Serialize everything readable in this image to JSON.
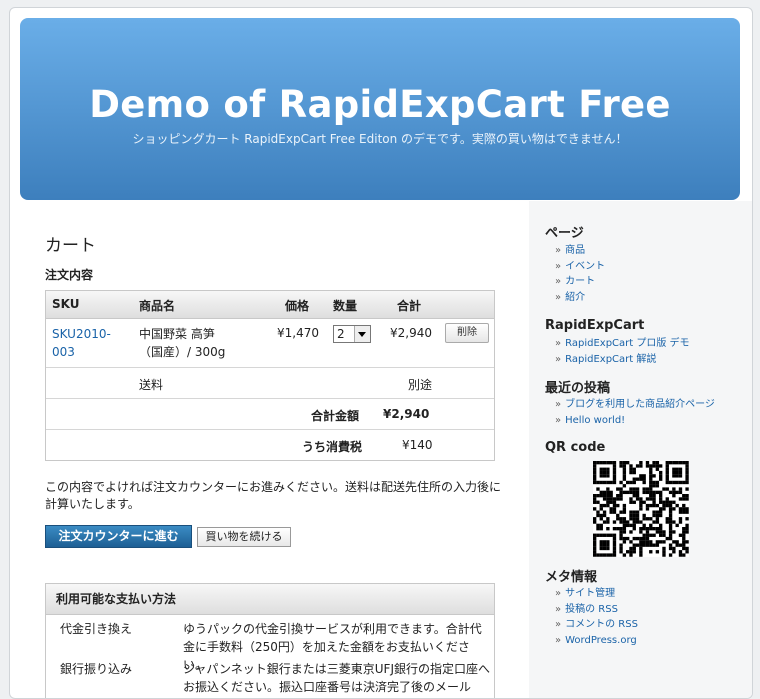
{
  "header": {
    "title": "Demo of RapidExpCart Free",
    "description": "ショッピングカート RapidExpCart Free Editon のデモです。実際の買い物はできません！"
  },
  "main": {
    "title": "カート",
    "order_heading": "注文内容",
    "table": {
      "headers": {
        "sku": "SKU",
        "name": "商品名",
        "price": "価格",
        "qty": "数量",
        "total": "合計"
      },
      "item": {
        "sku_line1": "SKU2010-",
        "sku_line2": "003",
        "name_line1": "中国野菜 高笋",
        "name_line2": "（国産）/ 300g",
        "price": "¥1,470",
        "qty": "2",
        "total": "¥2,940",
        "delete_label": "削除"
      },
      "shipping": {
        "label": "送料",
        "value": "別途"
      },
      "grand_total": {
        "label": "合計金額",
        "value": "¥2,940"
      },
      "tax": {
        "label": "うち消費税",
        "value": "¥140"
      }
    },
    "notice": "この内容でよければ注文カウンターにお進みください。送料は配送先住所の入力後に計算いたします。",
    "checkout_button": "注文カウンターに進む",
    "continue_button": "買い物を続ける",
    "payment": {
      "heading": "利用可能な支払い方法",
      "methods": [
        {
          "name": "代金引き換え",
          "desc": "ゆうパックの代金引換サービスが利用できます。合計代金に手数料（250円）を加えた金額をお支払いください。"
        },
        {
          "name": "銀行振り込み",
          "desc": "ジャパンネット銀行または三菱東京UFJ銀行の指定口座へお振込ください。振込口座番号は決済完了後のメール"
        }
      ]
    }
  },
  "sidebar": {
    "pages": {
      "heading": "ページ",
      "items": [
        "商品",
        "イベント",
        "カート",
        "紹介"
      ]
    },
    "rapid": {
      "heading": "RapidExpCart",
      "items": [
        "RapidExpCart プロ版 デモ",
        "RapidExpCart 解説"
      ]
    },
    "recent": {
      "heading": "最近の投稿",
      "items": [
        "ブログを利用した商品紹介ページ",
        "Hello world!"
      ]
    },
    "qr": {
      "heading": "QR code"
    },
    "meta": {
      "heading": "メタ情報",
      "items": [
        "サイト管理",
        "投稿の RSS",
        "コメントの RSS",
        "WordPress.org"
      ]
    }
  }
}
